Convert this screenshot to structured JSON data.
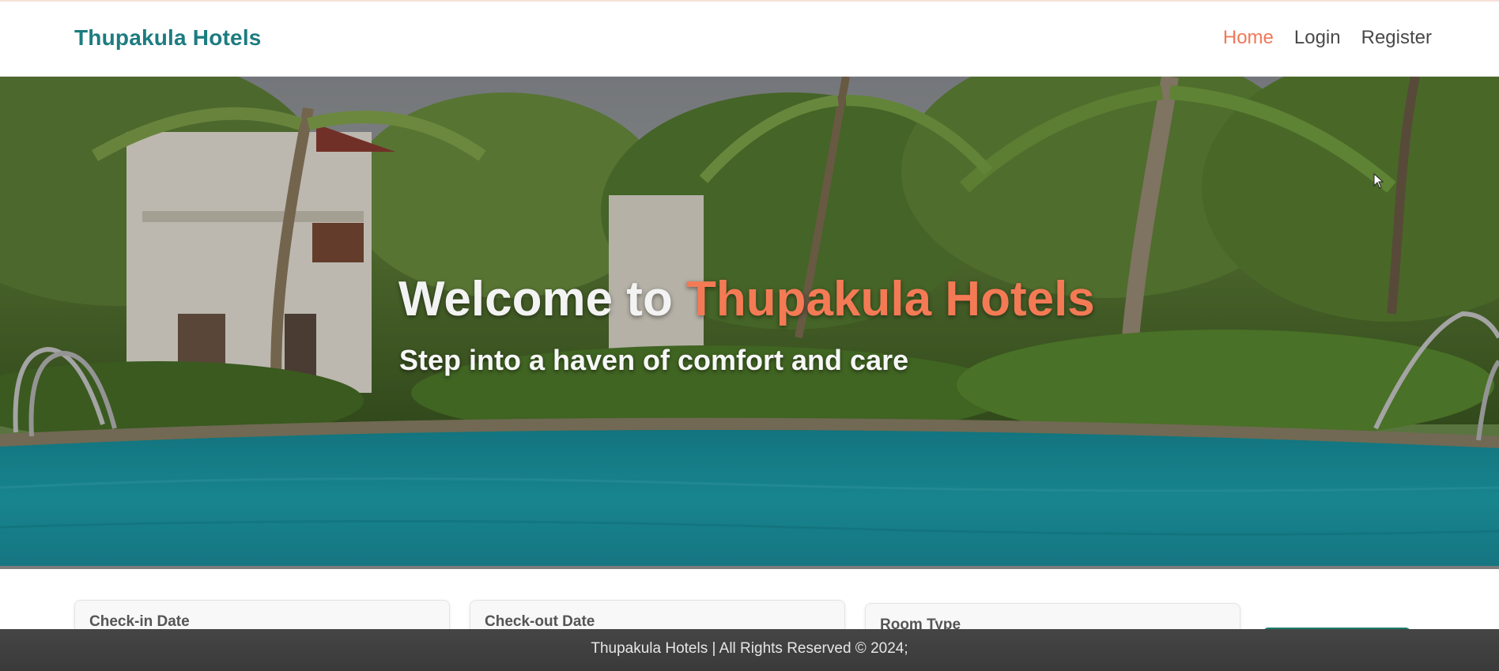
{
  "navbar": {
    "brand": "Thupakula Hotels",
    "links": [
      {
        "label": "Home",
        "active": true
      },
      {
        "label": "Login",
        "active": false
      },
      {
        "label": "Register",
        "active": false
      }
    ]
  },
  "hero": {
    "title_prefix": "Welcome to ",
    "title_accent": "Thupakula Hotels",
    "subtitle": "Step into a haven of comfort and care"
  },
  "booking": {
    "checkin_label": "Check-in Date",
    "checkout_label": "Check-out Date",
    "room_type_label": "Room Type"
  },
  "footer": {
    "text": "Thupakula Hotels | All Rights Reserved © 2024;"
  },
  "colors": {
    "brand": "#1d7c80",
    "accent": "#f47a55",
    "active_nav": "#f07858",
    "footer_bg": "#3f3f3f",
    "pool": "#1f9aa5"
  }
}
